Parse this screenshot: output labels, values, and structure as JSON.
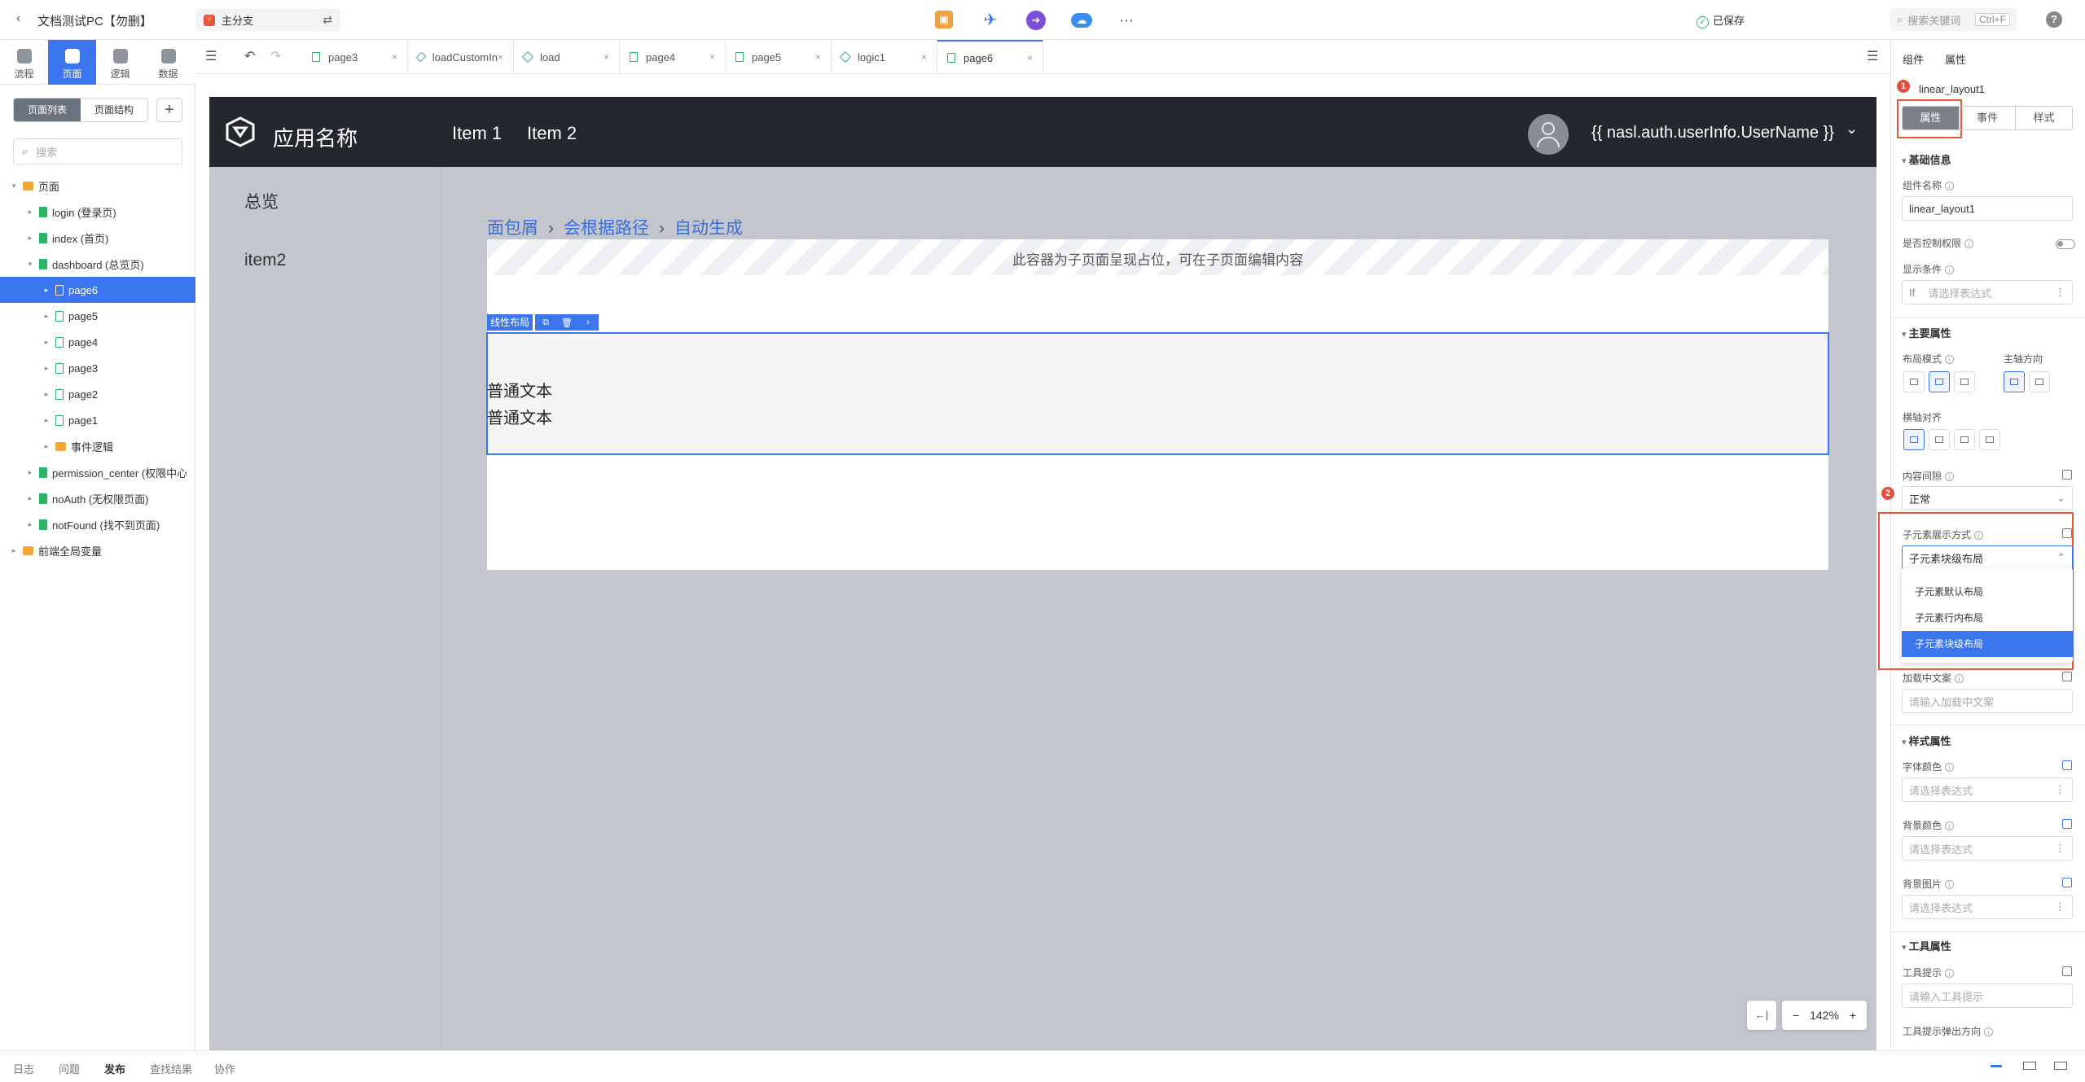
{
  "topbar": {
    "title": "文档测试PC【勿删】",
    "branch": "主分支",
    "saved": "已保存",
    "search_placeholder": "搜索关键词",
    "search_shortcut": "Ctrl+F",
    "help": "?"
  },
  "rail": {
    "tabs": [
      {
        "label": "流程",
        "icon": "flow-icon"
      },
      {
        "label": "页面",
        "icon": "page-icon"
      },
      {
        "label": "逻辑",
        "icon": "logic-icon"
      },
      {
        "label": "数据",
        "icon": "data-icon"
      }
    ],
    "active": "页面"
  },
  "leftpanel": {
    "segments": [
      "页面列表",
      "页面结构"
    ],
    "add": "+",
    "search_placeholder": "搜索",
    "tree": [
      {
        "label": "页面",
        "type": "folder",
        "depth": 0,
        "caret": "▾"
      },
      {
        "label": "login (登录页)",
        "type": "page",
        "depth": 1,
        "caret": "▸"
      },
      {
        "label": "index (首页)",
        "type": "page",
        "depth": 1,
        "caret": "▸"
      },
      {
        "label": "dashboard (总览页)",
        "type": "page",
        "depth": 1,
        "caret": "▾"
      },
      {
        "label": "page6",
        "type": "subpage",
        "depth": 2,
        "caret": "▸",
        "selected": true
      },
      {
        "label": "page5",
        "type": "subpage",
        "depth": 2,
        "caret": "▸"
      },
      {
        "label": "page4",
        "type": "subpage",
        "depth": 2,
        "caret": "▸"
      },
      {
        "label": "page3",
        "type": "subpage",
        "depth": 2,
        "caret": "▸"
      },
      {
        "label": "page2",
        "type": "subpage",
        "depth": 2,
        "caret": "▸"
      },
      {
        "label": "page1",
        "type": "subpage",
        "depth": 2,
        "caret": "▸"
      },
      {
        "label": "事件逻辑",
        "type": "folder",
        "depth": 2,
        "caret": "▸"
      },
      {
        "label": "permission_center (权限中心)",
        "type": "page",
        "depth": 1,
        "caret": "▸"
      },
      {
        "label": "noAuth (无权限页面)",
        "type": "page",
        "depth": 1,
        "caret": "▸"
      },
      {
        "label": "notFound (找不到页面)",
        "type": "page",
        "depth": 1,
        "caret": "▸"
      },
      {
        "label": "前端全局变量",
        "type": "folder",
        "depth": 0,
        "caret": "▸"
      }
    ]
  },
  "tabs": [
    {
      "label": "page3",
      "kind": "page"
    },
    {
      "label": "loadCustomInfoList",
      "kind": "logic"
    },
    {
      "label": "load",
      "kind": "logic"
    },
    {
      "label": "page4",
      "kind": "page"
    },
    {
      "label": "page5",
      "kind": "page"
    },
    {
      "label": "logic1",
      "kind": "logic"
    },
    {
      "label": "page6",
      "kind": "page",
      "active": true
    }
  ],
  "app": {
    "name": "应用名称",
    "nav": [
      "Item 1",
      "Item 2"
    ],
    "username": "{{ nasl.auth.userInfo.UserName }}",
    "sidebar": [
      "总览",
      "item2"
    ],
    "breadcrumb": [
      "面包屑",
      "会根据路径",
      "自动生成"
    ],
    "placeholder": "此容器为子页面呈现占位，可在子页面编辑内容",
    "linear_label": "线性布局",
    "texts": [
      "普通文本",
      "普通文本"
    ],
    "zoom": "142%"
  },
  "props": {
    "panel_tabs": [
      "组件",
      "属性"
    ],
    "component": "linear_layout1",
    "tabs": [
      "属性",
      "事件",
      "样式"
    ],
    "sections": {
      "basic": "基础信息",
      "main": "主要属性",
      "style": "样式属性",
      "tool": "工具属性"
    },
    "fields": {
      "name_label": "组件名称",
      "name_value": "linear_layout1",
      "auth_label": "是否控制权限",
      "cond_label": "显示条件",
      "cond_prefix": "If",
      "cond_placeholder": "请选择表达式",
      "mode_label": "布局模式",
      "dir_label": "主轴方向",
      "align_label": "横轴对齐",
      "gap_label": "内容间隙",
      "gap_value": "正常",
      "child_label": "子元素展示方式",
      "child_value": "子元素块级布局",
      "loading_label": "加载中文案",
      "loading_placeholder": "请输入加载中文案",
      "fontcolor_label": "字体颜色",
      "bgcolor_label": "背景颜色",
      "bgimg_label": "背景图片",
      "expr_placeholder": "请选择表达式",
      "tooltip_label": "工具提示",
      "tooltip_placeholder": "请输入工具提示",
      "tooltip_dir_label": "工具提示弹出方向"
    },
    "child_options": [
      "子元素默认布局",
      "子元素行内布局",
      "子元素块级布局"
    ],
    "child_selected": "子元素块级布局",
    "badges": [
      "1",
      "2"
    ]
  },
  "bottombar": [
    "日志",
    "问题",
    "发布",
    "查找结果",
    "协作"
  ],
  "bottom_active": "发布",
  "colors": {
    "accent": "#3b75f0",
    "annotation": "#e8573a",
    "app_nav": "#24272d",
    "canvas": "#c3c6cd"
  }
}
